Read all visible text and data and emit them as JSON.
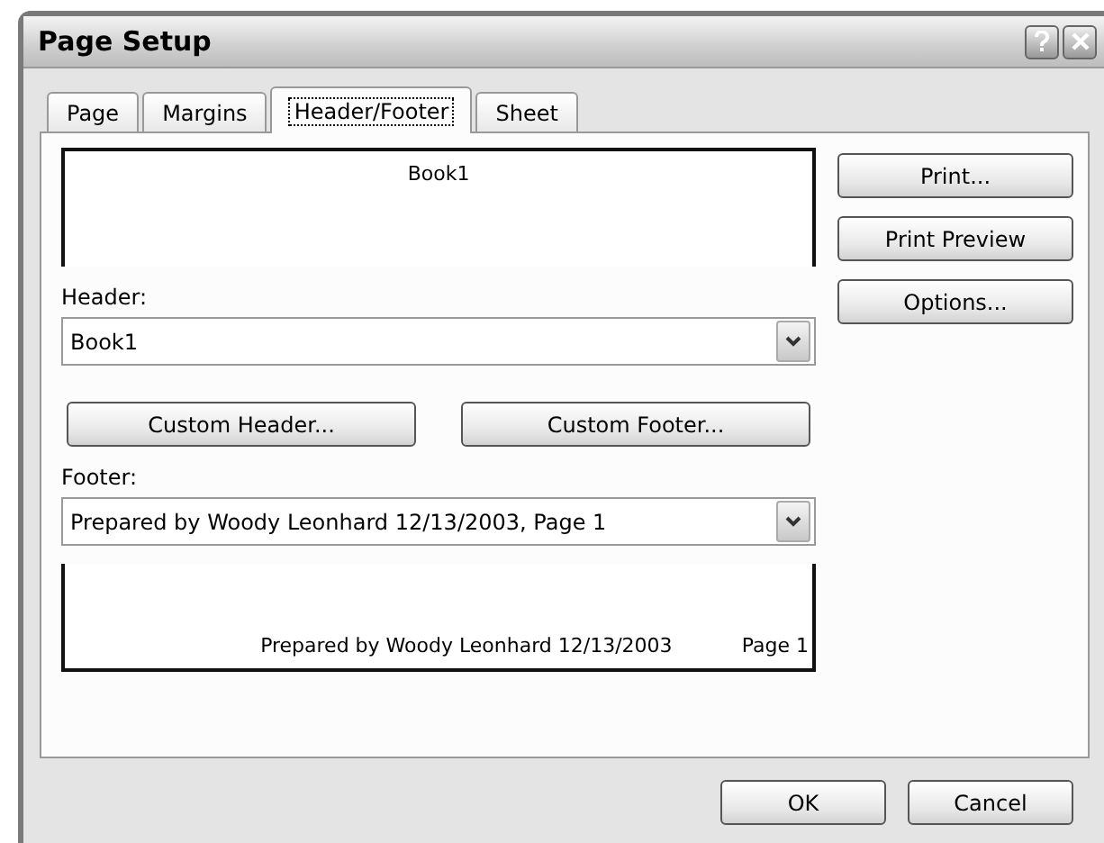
{
  "window": {
    "title": "Page Setup"
  },
  "tabs": [
    {
      "label": "Page",
      "selected": false
    },
    {
      "label": "Margins",
      "selected": false
    },
    {
      "label": "Header/Footer",
      "selected": true
    },
    {
      "label": "Sheet",
      "selected": false
    }
  ],
  "header_preview": {
    "center": "Book1"
  },
  "header": {
    "label": "Header:",
    "value": "Book1"
  },
  "custom_buttons": [
    "Custom Header...",
    "Custom Footer..."
  ],
  "footer": {
    "label": "Footer:",
    "value": "Prepared by Woody Leonhard 12/13/2003, Page 1"
  },
  "footer_preview": {
    "center": "Prepared by Woody Leonhard 12/13/2003",
    "right": "Page 1"
  },
  "side_buttons": [
    "Print...",
    "Print Preview",
    "Options..."
  ],
  "buttons": [
    "OK",
    "Cancel"
  ]
}
